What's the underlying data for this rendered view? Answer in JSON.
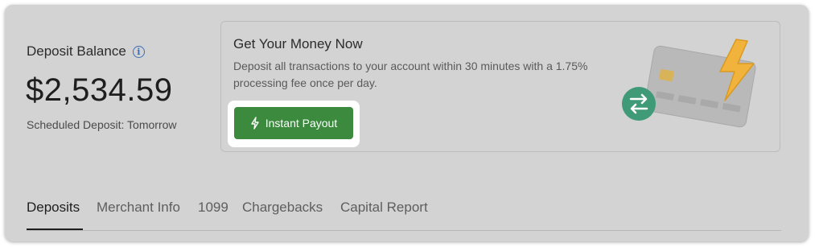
{
  "balance": {
    "label": "Deposit Balance",
    "amount": "$2,534.59",
    "scheduled": "Scheduled Deposit: Tomorrow"
  },
  "promo": {
    "title": "Get Your Money Now",
    "description": "Deposit all transactions to your account within 30 minutes with a 1.75% processing fee once per day.",
    "button_label": "Instant Payout",
    "button_color": "#3b8a3e"
  },
  "tabs": [
    {
      "label": "Deposits",
      "active": true
    },
    {
      "label": "Merchant Info",
      "active": false
    },
    {
      "label": "1099",
      "active": false
    },
    {
      "label": "Chargebacks",
      "active": false
    },
    {
      "label": "Capital Report",
      "active": false
    }
  ],
  "icons": {
    "info": "info-icon",
    "lightning": "lightning-icon",
    "card": "credit-card-illustration",
    "transfer": "transfer-arrows-icon"
  }
}
